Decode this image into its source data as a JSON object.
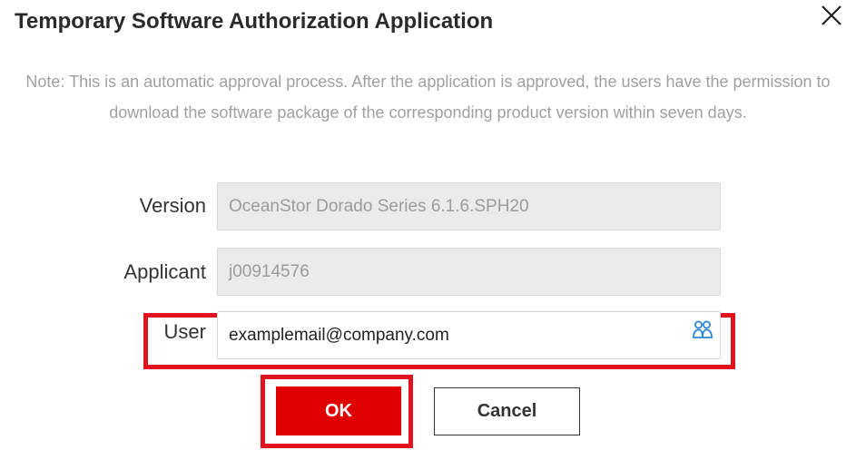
{
  "dialog": {
    "title": "Temporary Software Authorization Application",
    "note": "Note: This is an automatic approval process. After the application is approved, the users have the permission to download the software package of the corresponding product version within seven days."
  },
  "form": {
    "version": {
      "label": "Version",
      "value": "OceanStor Dorado Series 6.1.6.SPH20"
    },
    "applicant": {
      "label": "Applicant",
      "value": "j00914576"
    },
    "user": {
      "label": "User",
      "value": "examplemail@company.com"
    }
  },
  "buttons": {
    "ok_label": "OK",
    "cancel_label": "Cancel"
  },
  "icons": {
    "close": "close-icon",
    "user_picker": "users-icon"
  },
  "colors": {
    "primary_button": "#e00000",
    "highlight": "#e0141e",
    "note_text": "#a0a0a0",
    "readonly_field_bg": "#ebebeb"
  }
}
